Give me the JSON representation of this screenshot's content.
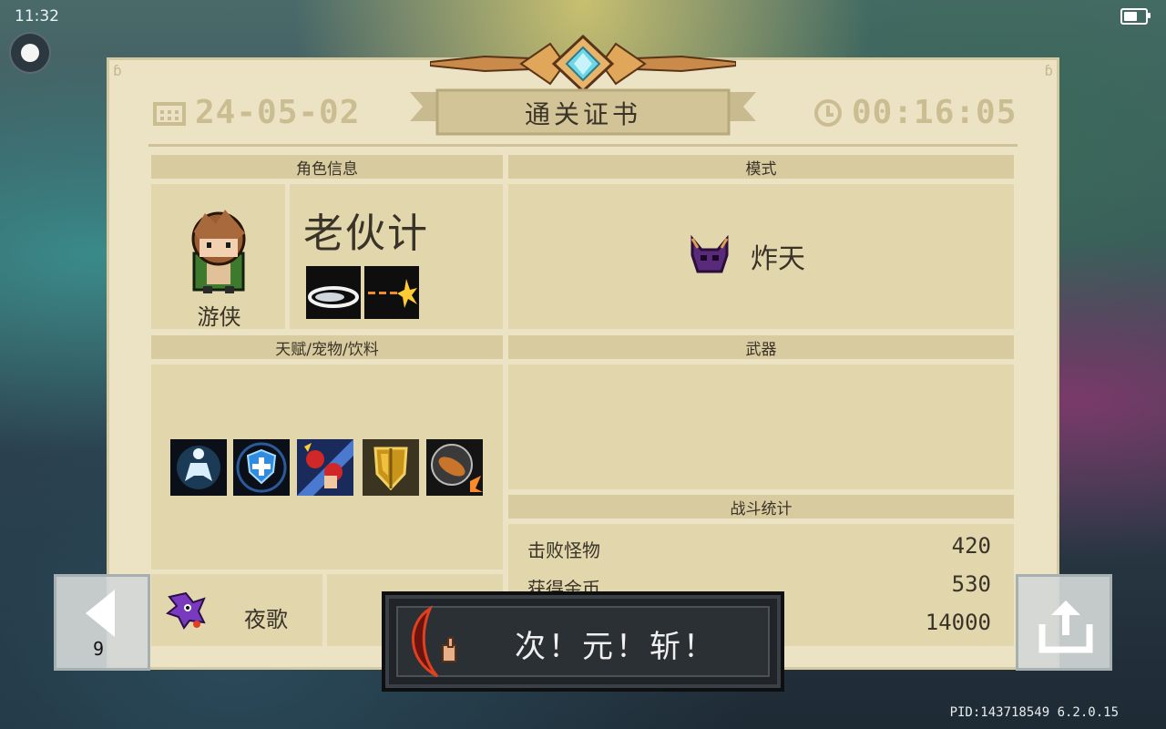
{
  "status_bar": {
    "time": "11:32",
    "battery_icon": "battery-icon"
  },
  "certificate": {
    "title": "通关证书",
    "date": "24-05-02",
    "duration": "00:16:05",
    "sections": {
      "character_info": "角色信息",
      "mode": "模式",
      "talents_pets_drinks": "天赋/宠物/饮料",
      "weapons": "武器",
      "battle_stats": "战斗统计"
    },
    "character": {
      "name": "老伙计",
      "class": "游侠",
      "skill_icons": [
        "dash-slash-icon",
        "gun-burst-icon"
      ]
    },
    "mode": {
      "name": "炸天",
      "icon": "demon-horns-icon"
    },
    "talent_icons": [
      "meditation-icon",
      "shield-plus-icon",
      "boxing-glove-icon",
      "golden-shield-icon",
      "sausage-icon"
    ],
    "pet": {
      "name": "夜歌",
      "icon": "purple-bird-icon"
    },
    "stats": [
      {
        "label": "击败怪物",
        "value": "420"
      },
      {
        "label": "获得金币",
        "value": "530"
      },
      {
        "label": "",
        "value": "14000"
      }
    ]
  },
  "weapon_popup": {
    "name": "次！元！斩！",
    "icon": "crescent-blade-icon"
  },
  "controls": {
    "prev_count": "9",
    "back_icon": "arrow-left-icon",
    "share_icon": "share-icon"
  },
  "footer": {
    "pid": "PID:143718549 6.2.0.15"
  },
  "colors": {
    "paper": "#ece3c4",
    "header": "#d8cb9f",
    "cell": "#e2d6ad",
    "text": "#3a3428",
    "faded": "#cbbd92"
  }
}
